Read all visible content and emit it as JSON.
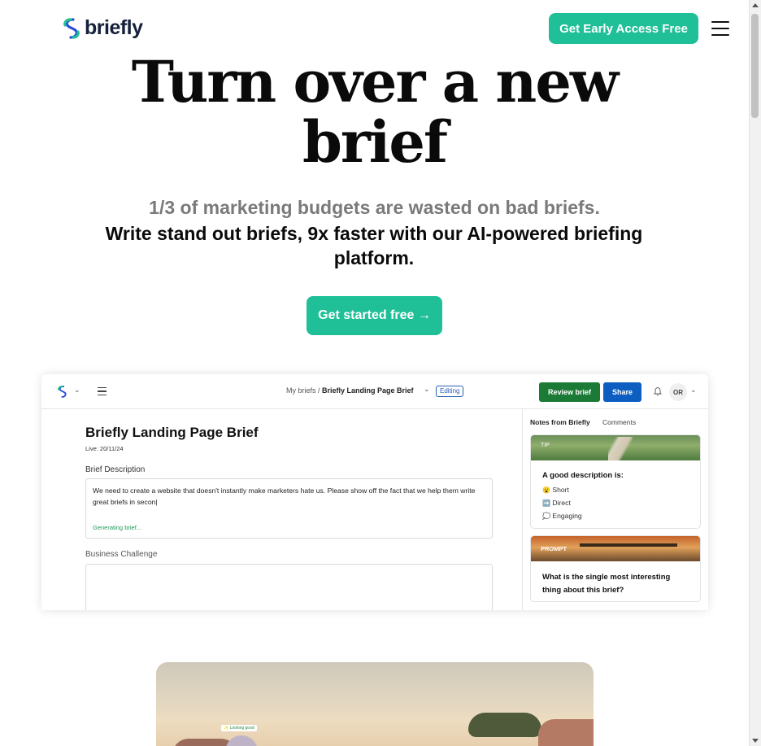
{
  "header": {
    "logo_text": "briefly",
    "cta_label": "Get Early Access Free",
    "menu_icon": "hamburger-menu-icon"
  },
  "hero": {
    "title_line1": "Turn over a new",
    "title_line2": "brief",
    "subtitle_gray": "1/3 of marketing budgets are wasted on bad briefs.",
    "subtitle_main": "Write stand out briefs, 9x faster with our AI-powered briefing platform.",
    "cta_label": "Get started free →"
  },
  "app": {
    "breadcrumb_root": "My briefs",
    "breadcrumb_sep": " / ",
    "breadcrumb_current": "Briefly Landing Page Brief",
    "editing_badge": "Editing",
    "review_button": "Review brief",
    "share_button": "Share",
    "avatar_initials": "OR",
    "doc_title": "Briefly Landing Page Brief",
    "doc_live": "Live: 20/11/24",
    "desc_label": "Brief Description",
    "desc_text": "We need to create a website that doesn't instantly make marketers hate us. Please show off the fact that we help them write great briefs in secon|",
    "generating_text": "Generating brief...",
    "challenge_label": "Business Challenge",
    "side_tab_notes": "Notes from Briefly",
    "side_tab_comments": "Comments",
    "tip_card": {
      "tag": "TIP",
      "heading": "A good description is:",
      "items": [
        {
          "emoji": "😮",
          "label": "Short"
        },
        {
          "emoji": "➡️",
          "label": "Direct"
        },
        {
          "emoji": "💭",
          "label": "Engaging"
        }
      ]
    },
    "prompt_card": {
      "tag": "PROMPT",
      "question": "What is the single most interesting thing about this brief?"
    }
  },
  "photo": {
    "tag": "✨ Looking good"
  },
  "colors": {
    "brand_green": "#1fbf97",
    "review_green": "#1b7a35",
    "share_blue": "#0c5ec1"
  }
}
